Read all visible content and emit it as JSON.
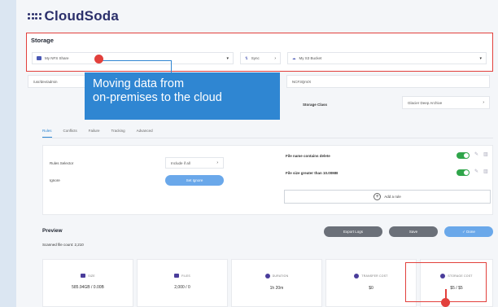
{
  "brand": {
    "name": "CloudSoda"
  },
  "storage": {
    "title": "Storage",
    "source": {
      "value": "My NFS Share"
    },
    "sync": {
      "label": "Sync"
    },
    "destination": {
      "value": "My S3 Bucket"
    },
    "source_path": "/usr/dev/admin",
    "dest_path": "NCF3Qm/X",
    "storage_class_label": "Storage Class",
    "storage_class_value": "Glacier Deep Archive"
  },
  "callout": {
    "line1": "Moving data from",
    "line2": "on-premises to the cloud"
  },
  "tabs": [
    {
      "label": "Rules"
    },
    {
      "label": "Conflicts"
    },
    {
      "label": "Failure"
    },
    {
      "label": "Tracking"
    },
    {
      "label": "Advanced"
    }
  ],
  "rules": {
    "selector_label": "Rules Selector",
    "selector_value": "Include if all",
    "ignore_label": "Ignore",
    "set_ignore": "Set Ignore",
    "criteria": [
      {
        "text": "File name contains  delete",
        "enabled": true
      },
      {
        "text": "File size greater than  10.00MB",
        "enabled": true
      }
    ],
    "add_rule": "Add a rule"
  },
  "preview": {
    "title": "Preview",
    "scanned": "Scanned file count: 2,210",
    "buttons": {
      "export": "Export Logs",
      "save": "Save",
      "done": "✓ Done"
    },
    "cards": [
      {
        "caption": "SIZE",
        "value": "585.94GB / 0.00B",
        "icon": "folder-icon"
      },
      {
        "caption": "FILES",
        "value": "2,000 / 0",
        "icon": "file-icon"
      },
      {
        "caption": "DURATION",
        "value": "1h 20m",
        "icon": "clock-icon"
      },
      {
        "caption": "TRANSFER COST",
        "value": "$0",
        "icon": "dollar-icon"
      },
      {
        "caption": "STORAGE COST",
        "value": "$5 / $5",
        "icon": "dollar-icon"
      }
    ]
  },
  "colors": {
    "accent": "#2f86d2",
    "highlight": "#e2403c",
    "toggle_on": "#2fa54a",
    "brand": "#2b2f6b"
  }
}
